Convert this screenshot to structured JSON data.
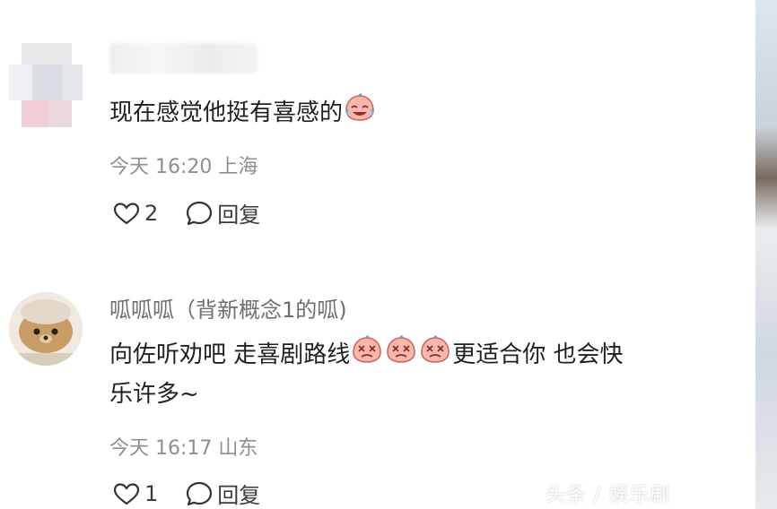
{
  "comments": [
    {
      "text": "现在感觉他挺有喜感的",
      "emoji": "crying-laughing-face-icon",
      "time": "今天 16:20",
      "location": "上海",
      "likes": "2",
      "reply_label": "回复"
    },
    {
      "username": "呱呱呱（背新概念1的呱)",
      "text_part1": "向佐听劝吧 走喜剧路线",
      "emojis": [
        "dizzy-face-icon",
        "dizzy-face-icon",
        "dizzy-face-icon"
      ],
      "text_part2": "更适合你 也会快",
      "text_line2": "乐许多~",
      "time": "今天 16:17",
      "location": "山东",
      "likes": "1",
      "reply_label": "回复"
    }
  ],
  "watermark": "头条 / 娱乐剧",
  "colors": {
    "text": "#1f1f1f",
    "meta": "#8e8e8e",
    "emoji_pink": "#f4a9a0"
  }
}
